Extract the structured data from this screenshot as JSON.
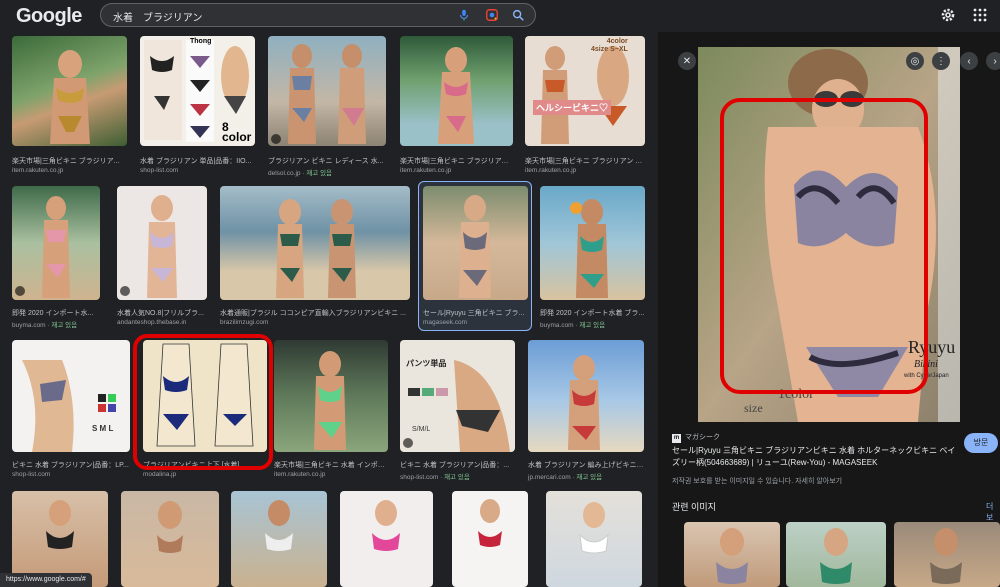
{
  "header": {
    "logo": "Google",
    "query": "水着　ブラジリアン"
  },
  "icons": {
    "mic": "mic-icon",
    "lens": "google-lens-icon",
    "search": "search-icon",
    "settings": "gear-icon",
    "apps": "apps-grid-icon"
  },
  "results": [
    {
      "caption": "楽天市場|三角ビキニ ブラジリア...",
      "source": "item.rakuten.co.jp",
      "free": ""
    },
    {
      "caption": "水着 ブラジリアン 単品|品番：IIO...",
      "source": "shop-list.com",
      "free": ""
    },
    {
      "caption": "ブラジリアン ビキニ レディース 水...",
      "source": "delsol.co.jp",
      "free": "재고 있음"
    },
    {
      "caption": "楽天市場|三角ビキニ ブラジリアン...",
      "source": "item.rakuten.co.jp",
      "free": ""
    },
    {
      "caption": "楽天市場|三角ビキニ ブラジリアン セク...",
      "source": "item.rakuten.co.jp",
      "free": ""
    },
    {
      "caption": "即発 2020 インポート水...",
      "source": "buyma.com",
      "free": "재고 있음"
    },
    {
      "caption": "水着人気NO.8|フリルブラ...",
      "source": "andanteshop.thebase.in",
      "free": ""
    },
    {
      "caption": "水着通販|ブラジル ココンピア直輸入ブラジリアンビキニ ...",
      "source": "brazilimzugi.com",
      "free": ""
    },
    {
      "caption": "セール|Ryuyu 三角ビキニ ブラ...",
      "source": "magaseek.com",
      "free": ""
    },
    {
      "caption": "即発 2020 インポート水着 ブラ...",
      "source": "buyma.com",
      "free": "재고 있음"
    },
    {
      "caption": "ビキニ 水着 ブラジリアン|品番：LP...",
      "source": "shop-list.com",
      "free": ""
    },
    {
      "caption": "ブラジリアンビキニ上下 [水着]",
      "source": "modalina.jp",
      "free": ""
    },
    {
      "caption": "楽天市場|三角ビキニ 水着 インポートビキニ ...",
      "source": "item.rakuten.co.jp",
      "free": ""
    },
    {
      "caption": "ビキニ 水着 ブラジリアン|品番：...",
      "source": "shop-list.com",
      "free": "재고 있음"
    },
    {
      "caption": "水着 ブラジリアン 編み上げビキニ ...",
      "source": "jp.mercari.com",
      "free": "재고 있음"
    }
  ],
  "overlays": {
    "thong_label": "Thong",
    "color8": "8\ncolor",
    "color4size": "4color\n4size S~XL",
    "healthy_bikini": "ヘルシービキニ♡",
    "pants_only": "パンツ単品",
    "sml": "S M L",
    "sml2": "S/M/L",
    "ryuyu_brand": "Ryuyu",
    "bikini": "Bikini",
    "cyberjapan": "with CyberJapan",
    "color": "1color",
    "size": "size"
  },
  "panel": {
    "site": "マガシーク",
    "title": "セール|Ryuyu 三角ビキニ ブラジリアンビキニ 水着 ホルターネックビキニ ベイズリー柄(504663689) | リューユ(Rew-You) - MAGASEEK",
    "note": "저작권 보호를 받는 이미지일 수 있습니다. 자세히 알아보기",
    "visit": "방문",
    "related": "관련 이미지",
    "more": "더보"
  },
  "status_url": "https://www.google.com/#"
}
